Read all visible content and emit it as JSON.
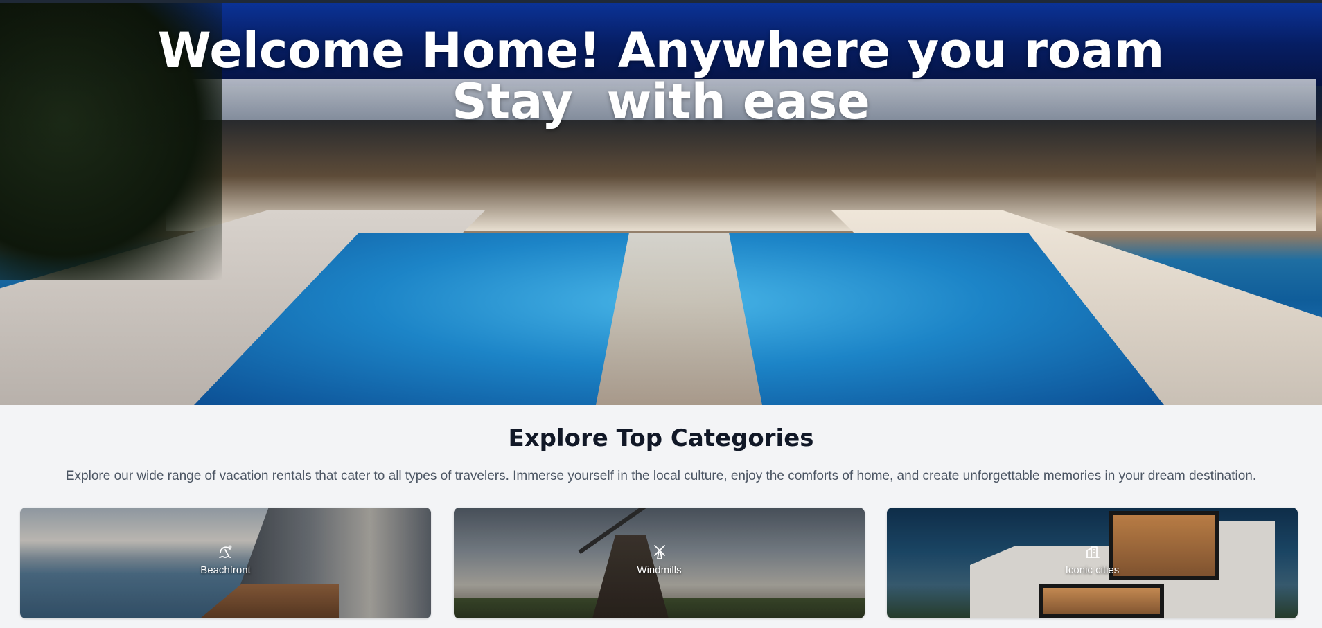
{
  "hero": {
    "title_line1": "Welcome Home! Anywhere you roam",
    "title_line2": "Stay  with ease"
  },
  "categories": {
    "title": "Explore Top Categories",
    "description": "Explore our wide range of vacation rentals that cater to all types of travelers. Immerse yourself in the local culture, enjoy the comforts of home, and create unforgettable memories in your dream destination.",
    "items": [
      {
        "label": "Beachfront",
        "icon": "beach-umbrella-icon"
      },
      {
        "label": "Windmills",
        "icon": "windmill-icon"
      },
      {
        "label": "Iconic cities",
        "icon": "city-buildings-icon"
      }
    ]
  }
}
